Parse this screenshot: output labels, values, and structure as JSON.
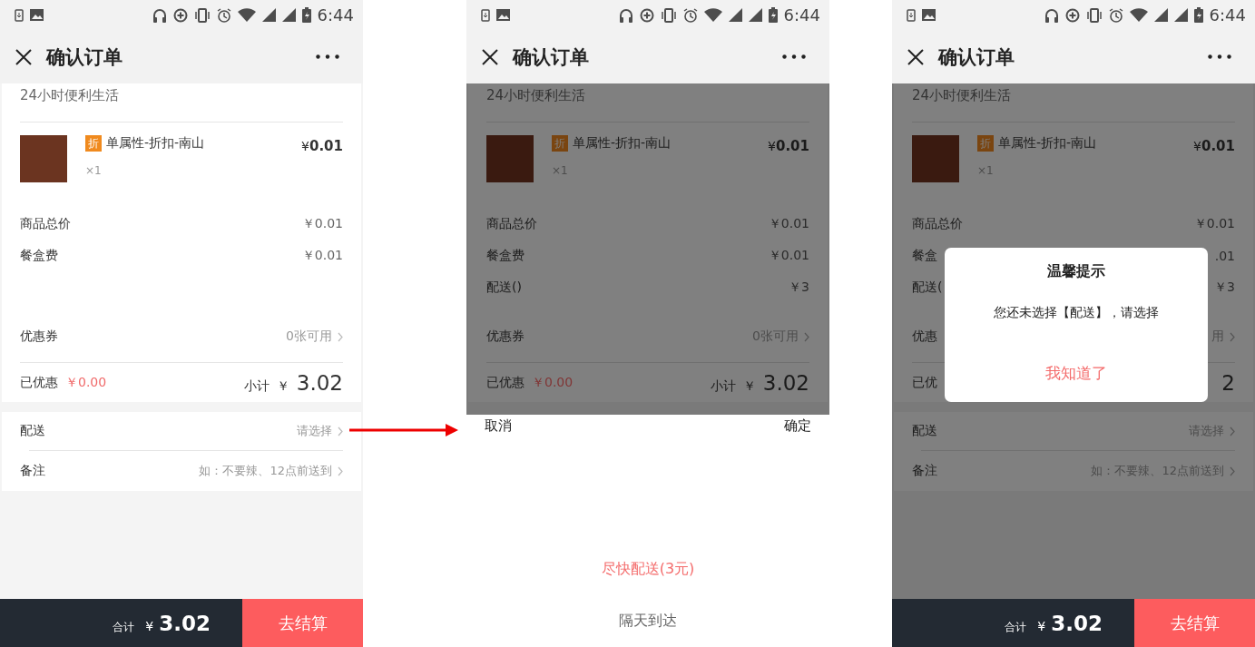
{
  "screens": [
    {
      "dimmed": false,
      "status_bar": {
        "time": "6:44"
      },
      "nav": {
        "title": "确认订单"
      },
      "shop_name": "24小时便利生活",
      "item": {
        "tag": "折",
        "name": "单属性-折扣-南山",
        "price": "¥**0.01**",
        "quantity": "×1"
      },
      "fees": [
        {
          "label": "商品总价",
          "value": "￥0.01"
        },
        {
          "label": "餐盒费",
          "value": "￥0.01"
        }
      ],
      "coupon": {
        "label": "优惠券",
        "value": "0张可用"
      },
      "discount": {
        "label": "已优惠",
        "value": "￥0.00"
      },
      "subtotal": {
        "label": "小计",
        "currency": "￥",
        "value": "3.02"
      },
      "options": [
        {
          "label": "配送",
          "value": "请选择"
        },
        {
          "label": "备注",
          "value": "如：不要辣、12点前送到"
        }
      ],
      "bottom_bar": {
        "total_label": "合计",
        "currency": "¥",
        "total": "3.02",
        "checkout": "去结算"
      }
    },
    {
      "dimmed": true,
      "status_bar": {
        "time": "6:44"
      },
      "nav": {
        "title": "确认订单"
      },
      "shop_name": "24小时便利生活",
      "item": {
        "tag": "折",
        "name": "单属性-折扣-南山",
        "price": "¥**0.01**",
        "quantity": "×1"
      },
      "fees": [
        {
          "label": "商品总价",
          "value": "￥0.01"
        },
        {
          "label": "餐盒费",
          "value": "￥0.01"
        },
        {
          "label": "配送()",
          "value": "￥3"
        }
      ],
      "coupon": {
        "label": "优惠券",
        "value": "0张可用"
      },
      "discount": {
        "label": "已优惠",
        "value": "￥0.00"
      },
      "subtotal": {
        "label": "小计",
        "currency": "￥",
        "value": "3.02"
      },
      "picker": {
        "cancel": "取消",
        "confirm": "确定",
        "choices": [
          {
            "label": "尽快配送(3元)",
            "selected": true
          },
          {
            "label": "隔天到达",
            "selected": false
          }
        ]
      }
    },
    {
      "dimmed": true,
      "status_bar": {
        "time": "6:44"
      },
      "nav": {
        "title": "确认订单"
      },
      "shop_name": "24小时便利生活",
      "item": {
        "tag": "折",
        "name": "单属性-折扣-南山",
        "price": "¥**0.01**",
        "quantity": "×1"
      },
      "fees": [
        {
          "label": "商品总价",
          "value": "￥0.01"
        },
        {
          "label": "餐盒",
          "value": ".01"
        },
        {
          "label": "配送(",
          "value": "￥3"
        }
      ],
      "coupon": {
        "label": "优惠",
        "value": "用"
      },
      "discount": {
        "label": "已优"
      },
      "subtotal": {
        "value": "2"
      },
      "options": [
        {
          "label": "配送",
          "value": "请选择"
        },
        {
          "label": "备注",
          "value": "如：不要辣、12点前送到"
        }
      ],
      "bottom_bar": {
        "total_label": "合计",
        "currency": "¥",
        "total": "3.02",
        "checkout": "去结算"
      },
      "dialog": {
        "title": "温馨提示",
        "message": "您还未选择【配送】，请选择",
        "button": "我知道了"
      }
    }
  ]
}
